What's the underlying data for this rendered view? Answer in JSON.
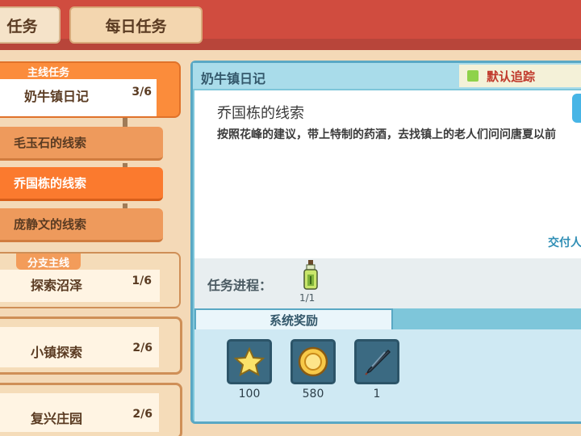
{
  "tabs": {
    "main_label": "任务",
    "daily_label": "每日任务"
  },
  "quest_list": {
    "main_group": {
      "badge": "主线任务",
      "title": "奶牛镇日记",
      "count": "3/6",
      "items": [
        {
          "label": "毛玉石的线索"
        },
        {
          "label": "乔国栋的线索"
        },
        {
          "label": "庞静文的线索"
        }
      ]
    },
    "branch_group": {
      "badge": "分支主线",
      "title": "探索沼泽",
      "count": "1/6"
    },
    "other_groups": [
      {
        "title": "小镇探索",
        "count": "2/6"
      },
      {
        "title": "复兴庄园",
        "count": "2/6"
      }
    ]
  },
  "detail": {
    "quest_name": "奶牛镇日记",
    "track_label": "默认追踪",
    "sub_title": "乔国栋的线索",
    "description": "按照花峰的建议，带上特制的药酒，去找镇上的老人们问问唐夏以前",
    "hand_in_label": "交付人",
    "progress_label": "任务进程：",
    "progress_count": "1/1",
    "progress_fraction": 1.0,
    "rewards_tab_label": "系统奖励",
    "rewards": [
      {
        "icon": "star-icon",
        "amount": "100"
      },
      {
        "icon": "gold-coin-icon",
        "amount": "580"
      },
      {
        "icon": "feather-pen-icon",
        "amount": "1"
      }
    ]
  },
  "colors": {
    "top_bar": "#d04c3f",
    "active_orange": "#fb8c3b",
    "panel_blue": "#7ec6da",
    "track_green": "#8fd24a",
    "track_text": "#c0392b"
  }
}
